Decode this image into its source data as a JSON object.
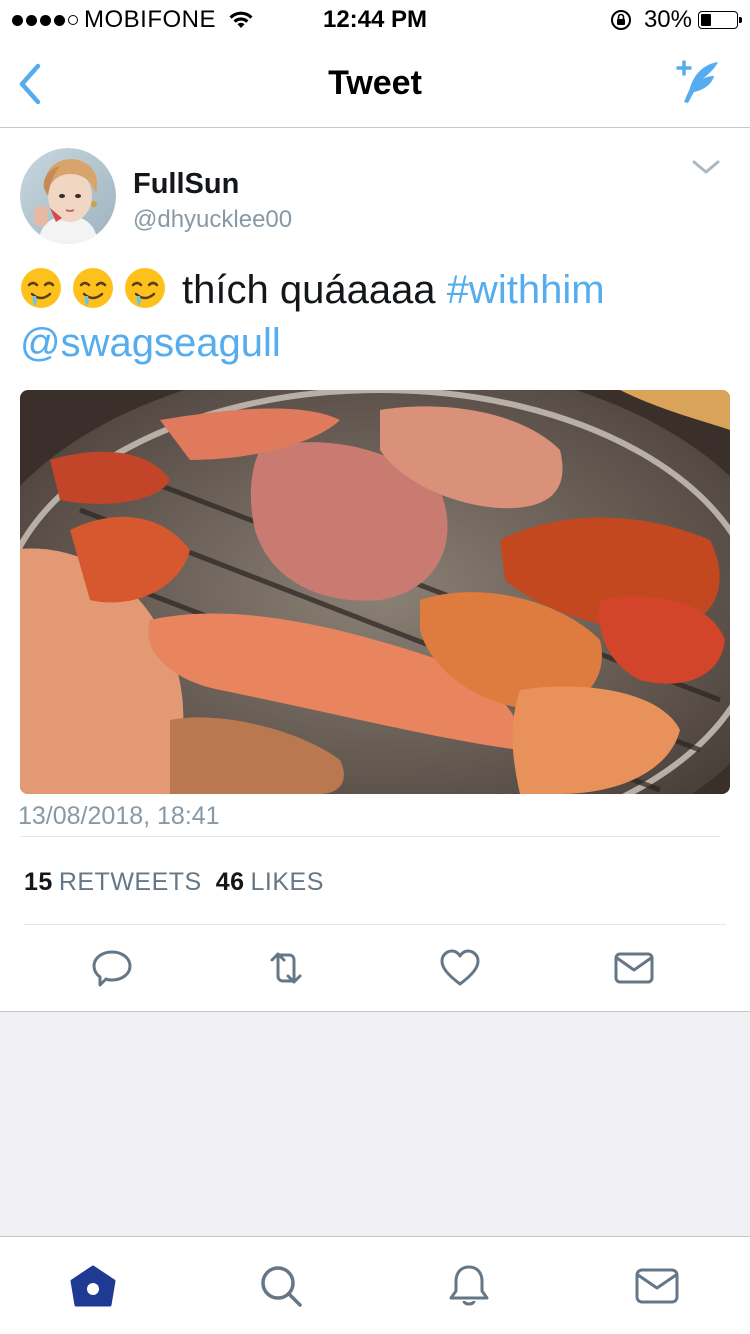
{
  "status_bar": {
    "carrier": "MOBIFONE",
    "time": "12:44 PM",
    "battery": "30%",
    "battery_level": 0.3
  },
  "nav": {
    "title": "Tweet",
    "back_icon": "chevron-left-icon",
    "compose_icon": "compose-tweet-icon"
  },
  "tweet": {
    "author_name": "FullSun",
    "author_handle": "@dhyucklee00",
    "text_emojis": [
      "drooling-face",
      "drooling-face",
      "drooling-face"
    ],
    "text_body": "thích quáaaaa",
    "hashtag": "#withhim",
    "mention": "@swagseagull",
    "timestamp": "13/08/2018, 18:41",
    "stats": {
      "retweets_count": "15",
      "retweets_label": "RETWEETS",
      "likes_count": "46",
      "likes_label": "LIKES"
    },
    "actions": [
      "reply-icon",
      "retweet-icon",
      "like-icon",
      "direct-message-icon"
    ]
  },
  "tab_bar": {
    "items": [
      "home-icon",
      "search-icon",
      "notifications-icon",
      "messages-icon"
    ],
    "active": "home"
  },
  "colors": {
    "accent": "#55acee",
    "tab_active": "#1f3a93",
    "icon_gray": "#657786",
    "muted_text": "#8899a6"
  }
}
